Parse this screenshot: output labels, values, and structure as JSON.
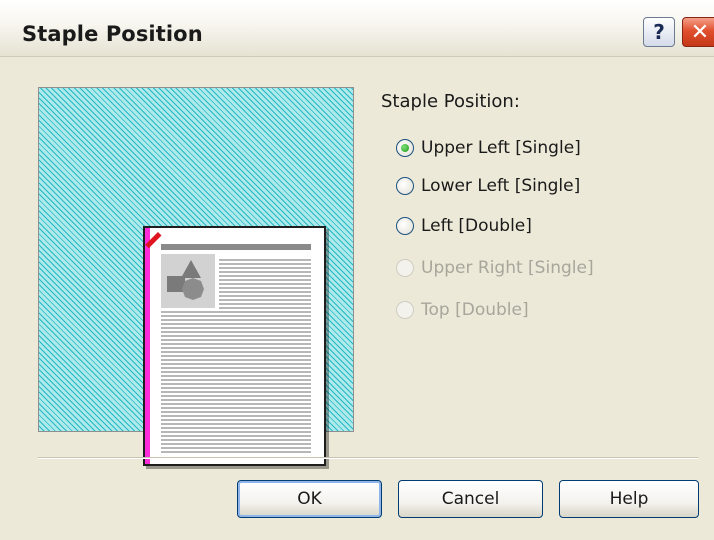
{
  "window": {
    "title": "Staple Position",
    "help_glyph": "?",
    "close_glyph": "✕"
  },
  "group": {
    "label": "Staple Position:",
    "options": [
      {
        "label": "Upper Left [Single]",
        "selected": true,
        "enabled": true
      },
      {
        "label": "Lower Left [Single]",
        "selected": false,
        "enabled": true
      },
      {
        "label": "Left [Double]",
        "selected": false,
        "enabled": true
      },
      {
        "label": "Upper Right [Single]",
        "selected": false,
        "enabled": false
      },
      {
        "label": "Top [Double]",
        "selected": false,
        "enabled": false
      }
    ]
  },
  "buttons": {
    "ok": "OK",
    "cancel": "Cancel",
    "help": "Help"
  },
  "icons": {
    "help": "question-mark-icon",
    "close": "close-icon",
    "radio": "radio-button-icon"
  },
  "colors": {
    "dialog_bg": "#ece9d8",
    "preview_hatch_light": "#aee9ec",
    "preview_hatch_dark": "#25b9c1",
    "binding_edge": "#ff2ad8",
    "staple_mark": "#e0141e",
    "radio_selected": "#1f9b1a"
  }
}
